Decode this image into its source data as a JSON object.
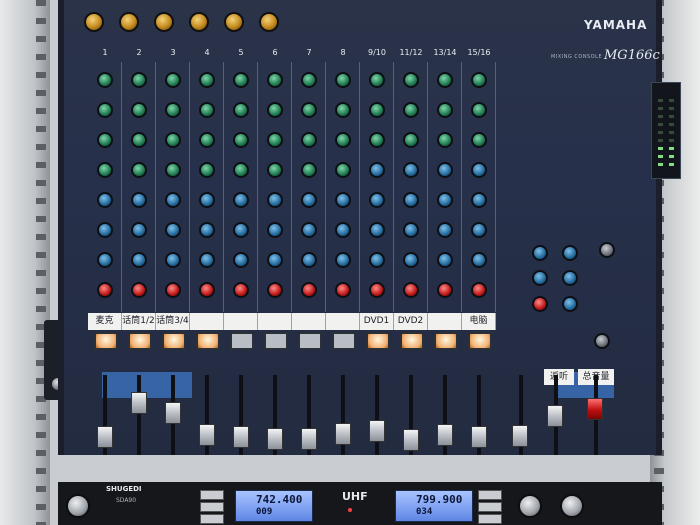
{
  "brand": "YAMAHA",
  "model": "MG166c",
  "model_label": "MIXING CONSOLE",
  "channel_numbers": [
    "1",
    "2",
    "3",
    "4",
    "5",
    "6",
    "7",
    "8",
    "9/10",
    "11/12",
    "13/14",
    "15/16"
  ],
  "channel_labels": [
    "麦克",
    "话筒1/2",
    "话筒3/4",
    "",
    "",
    "",
    "",
    "",
    "DVD1",
    "DVD2",
    "",
    "电脑"
  ],
  "return_label": "返听",
  "main_label": "总音量",
  "receiver": {
    "brand": "SHUGEDI",
    "model": "SDA90",
    "band": "UHF",
    "display_a": {
      "freq": "742.400",
      "channel": "009"
    },
    "display_b": {
      "freq": "799.900",
      "channel": "034"
    }
  },
  "fader_levels": [
    0.15,
    0.72,
    0.55,
    0.18,
    0.15,
    0.12,
    0.12,
    0.2,
    0.25,
    0.1,
    0.18,
    0.15,
    0.3,
    0.3,
    0.4
  ]
}
